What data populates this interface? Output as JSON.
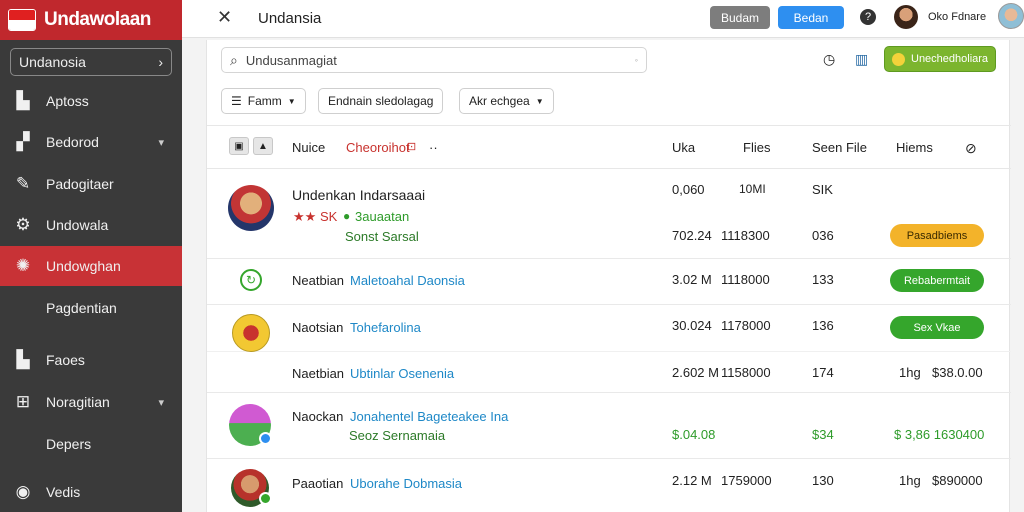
{
  "sidebar": {
    "brand": "Undawolaan",
    "selector": "Undanosia",
    "items": [
      {
        "label": "Aptoss",
        "icon": "building-icon"
      },
      {
        "label": "Bedorod",
        "icon": "org-icon",
        "chevron": true
      },
      {
        "label": "Padogitaer",
        "icon": "wrench-icon"
      },
      {
        "label": "Undowala",
        "icon": "gear-icon"
      },
      {
        "label": "Undowghan",
        "icon": "network-icon",
        "active": true
      },
      {
        "label": "Pagdentian",
        "sub": true
      },
      {
        "label": "Faoes",
        "icon": "building-icon"
      },
      {
        "label": "Noragitian",
        "icon": "plus-box-icon",
        "chevron": true
      },
      {
        "label": "Depers",
        "sub": true
      },
      {
        "label": "Vedis",
        "icon": "globe-icon"
      }
    ]
  },
  "topbar": {
    "title": "Undansia",
    "btn_grey": "Budam",
    "btn_blue": "Bedan",
    "user_name": "Oko Fdnare"
  },
  "toolbar": {
    "search_placeholder": "Undusanmagiat",
    "green_button": "Unechedholiara"
  },
  "filters": [
    {
      "label": "Famm"
    },
    {
      "label": "Endnain sledolagag"
    },
    {
      "label": "Akr echgea"
    }
  ],
  "table": {
    "headers": {
      "name": "Nuice",
      "tag": "Cheoroihot",
      "uka": "Uka",
      "files": "Flies",
      "seen": "Seen File",
      "items": "Hiems"
    },
    "rows": [
      {
        "title": "Undenkan Indarsaaai",
        "stars": "★★",
        "sk": "SK",
        "status": "3auaatan",
        "sub": "Sonst Sarsal",
        "v1a": "0,060",
        "v2a": "10MI",
        "v3a": "SIK",
        "v1": "702.24",
        "v2": "1118300",
        "v3": "036",
        "pill": "Pasadbiems"
      },
      {
        "prefix": "Neatbian",
        "link": "Maletoahal Daonsia",
        "v1": "3.02 M",
        "v2": "1118000",
        "v3": "133",
        "pill": "Rebabermtait"
      },
      {
        "prefix": "Naotsian",
        "link": "Tohefarolina",
        "v1": "30.024",
        "v2": "1178000",
        "v3": "136",
        "pill": "Sex Vkae"
      },
      {
        "prefix": "Naetbian",
        "link": "Ubtinlar Osenenia",
        "v1": "2.602 M",
        "v2": "1158000",
        "v3": "174",
        "v4": "1hg",
        "v5": "$38.0.00"
      },
      {
        "prefix": "Naockan",
        "link": "Jonahentel Bageteakee Ina",
        "sub": "Seoz Sernamaia",
        "v1": "$.04.08",
        "v3": "$34",
        "v5": "$ 3,86 1630400"
      },
      {
        "prefix": "Paaotian",
        "link": "Uborahe Dobmasia",
        "v1": "2.12 M",
        "v2": "1759000",
        "v3": "130",
        "v4": "1hg",
        "v5": "$890000"
      }
    ]
  },
  "colors": {
    "accent": "#c83236",
    "blue": "#2e8ff0",
    "green": "#35a62c",
    "orange": "#f3b32a"
  }
}
